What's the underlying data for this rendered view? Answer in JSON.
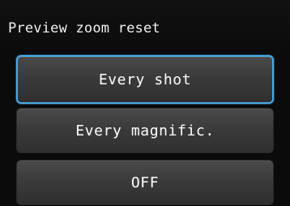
{
  "menu": {
    "title": "Preview zoom reset",
    "options": [
      {
        "label": "Every shot",
        "selected": true
      },
      {
        "label": "Every magnific.",
        "selected": false
      },
      {
        "label": "OFF",
        "selected": false
      }
    ]
  },
  "colors": {
    "background": "#0b0b0b",
    "button": "#3b3b3b",
    "selection_border": "#4aa9e6",
    "text": "#ffffff"
  }
}
